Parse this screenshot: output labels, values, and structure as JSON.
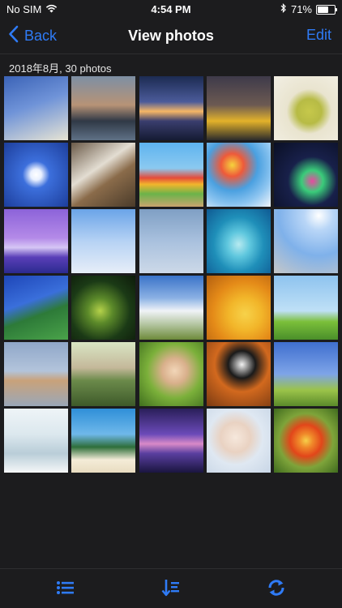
{
  "status_bar": {
    "carrier": "No SIM",
    "time": "4:54 PM",
    "battery_percent": "71%",
    "battery_level": 0.71
  },
  "nav": {
    "back_label": "Back",
    "title": "View photos",
    "edit_label": "Edit"
  },
  "section": {
    "header": "2018年8月, 30 photos"
  },
  "colors": {
    "accent": "#2f7bf6",
    "background": "#1c1c1e"
  },
  "photos": [
    {
      "subject": "child-windmill",
      "bg": "linear-gradient(160deg,#3b63b7 0%,#6f93d8 45%,#e7e4d4 100%)"
    },
    {
      "subject": "lakeside-castle",
      "bg": "linear-gradient(180deg,#7d8fa4 0%,#b79376 45%,#303946 70%,#5f7186 100%)"
    },
    {
      "subject": "sunset-horizon",
      "bg": "linear-gradient(180deg,#1c2b52 0%,#4b5b9a 40%,#f6b766 55%,#3a3e6e 70%,#151b33 100%)"
    },
    {
      "subject": "city-taxis",
      "bg": "linear-gradient(180deg,#3e3a4a 0%,#6c5a52 45%,#e3b22a 70%,#2b2b2b 100%)"
    },
    {
      "subject": "tea-cup",
      "bg": "radial-gradient(circle at 55% 55%,#c6c84b 0%,#b7bb45 25%,#e9e4cf 45%,#f2efe4 100%)"
    },
    {
      "subject": "blue-sky-cloud",
      "bg": "radial-gradient(ellipse at 50% 50%,#ffffff 0%,#e9f0ff 12%,#3c6fdc 30%,#1d3e9b 100%)"
    },
    {
      "subject": "plate-snacks",
      "bg": "linear-gradient(145deg,#6b5a48 0%,#e3ddd2 40%,#8a6b4a 60%,#4a3b2a 100%)"
    },
    {
      "subject": "beach-huts",
      "bg": "linear-gradient(180deg,#5eb4ef 0%,#8bc9f0 40%,#e44b3a 55%,#f2b52c 65%,#6bb34a 80%,#caa56e 100%)"
    },
    {
      "subject": "balloons",
      "bg": "radial-gradient(circle at 40% 35%,#f5d33c 0%,#ee5a3a 20%,#4aa0e0 45%,#8bc4f0 70%,#f2f5fa 100%)"
    },
    {
      "subject": "ferris-wheel-night",
      "bg": "radial-gradient(circle at 60% 60%,#e84aa0 0%,#3acc7a 20%,#18204a 45%,#0a0f24 100%)"
    },
    {
      "subject": "purple-trees",
      "bg": "linear-gradient(180deg,#8c63d9 0%,#b48ae8 45%,#d6c6f5 60%,#5a3fb8 75%,#2b2a8f 100%)"
    },
    {
      "subject": "ferris-wheel-day",
      "bg": "linear-gradient(180deg,#6aa4e8 0%,#b6d2f4 50%,#e7eef8 100%)"
    },
    {
      "subject": "laundry-clothesline",
      "bg": "linear-gradient(180deg,#7f9fc4 0%,#a9c1de 50%,#cdd9e8 100%)"
    },
    {
      "subject": "aerial-reef",
      "bg": "radial-gradient(ellipse at 50% 55%,#b7eaf0 0%,#5fc7de 25%,#1f8fb9 55%,#0f5a93 100%)"
    },
    {
      "subject": "man-basket",
      "bg": "radial-gradient(circle at 70% 10%,#ffffff 0%,#b9d6f7 20%,#7fb1ea 55%,#c7c7c7 100%)"
    },
    {
      "subject": "green-leaves-sky",
      "bg": "linear-gradient(160deg,#1e46b8 0%,#3a6fdb 40%,#2d7a38 60%,#4aa34a 100%)"
    },
    {
      "subject": "bubbles-bokeh",
      "bg": "radial-gradient(circle at 45% 55%,#b5d24a 0%,#5c8a2a 25%,#1b3a16 60%,#0d1a0a 100%)"
    },
    {
      "subject": "clouds-field",
      "bg": "linear-gradient(180deg,#3a73c8 0%,#8bb1e4 35%,#f0f3f7 55%,#b7c8a6 75%,#6d8a3a 100%)"
    },
    {
      "subject": "yellow-flower",
      "bg": "radial-gradient(circle at 60% 60%,#f7d24a 0%,#f2b62a 30%,#e48a18 60%,#b35f10 100%)"
    },
    {
      "subject": "bicycle-meadow",
      "bg": "linear-gradient(180deg,#8ec3ef 0%,#bfe0f6 55%,#7bbf3a 72%,#4a8f2a 100%)"
    },
    {
      "subject": "monkey-toy",
      "bg": "linear-gradient(180deg,#8fa7c9 0%,#b3c4db 45%,#c9a27a 60%,#9aa7b8 100%)"
    },
    {
      "subject": "kids-bikes",
      "bg": "linear-gradient(180deg,#d9e6c4 0%,#c4b89a 40%,#6b8a4a 60%,#3e5a2a 100%)"
    },
    {
      "subject": "girl-laughing",
      "bg": "radial-gradient(circle at 55% 45%,#f2d6b8 0%,#d9b08c 25%,#7bb03a 55%,#3f6e1e 100%)"
    },
    {
      "subject": "puppy-cushion",
      "bg": "radial-gradient(circle at 55% 35%,#f2f2f2 0%,#1a1a1a 25%,#d2691e 50%,#7a3a12 100%)"
    },
    {
      "subject": "boy-jumping",
      "bg": "linear-gradient(180deg,#3f6fcf 0%,#7ea4e8 50%,#9bc34a 75%,#5a8a2a 100%)"
    },
    {
      "subject": "white-dishes",
      "bg": "linear-gradient(180deg,#eef4f7 0%,#dce8ee 40%,#b9cdd8 70%,#f5f7f8 100%)"
    },
    {
      "subject": "palm-beach",
      "bg": "linear-gradient(180deg,#2f8fd8 0%,#6fb8ea 40%,#2e6e3a 60%,#f4ecd8 80%,#e8dcc0 100%)"
    },
    {
      "subject": "purple-dusk",
      "bg": "linear-gradient(180deg,#2a1f5a 0%,#6b4ab8 40%,#d98ac8 55%,#5a3fa0 70%,#1a1540 100%)"
    },
    {
      "subject": "baby-bubbles",
      "bg": "radial-gradient(circle at 45% 45%,#f6e8dc 0%,#e9d2c2 30%,#dfe8f2 55%,#c8d6e6 100%)"
    },
    {
      "subject": "red-gerbera",
      "bg": "radial-gradient(circle at 50% 50%,#f6d04a 0%,#f08a2a 15%,#e2461a 35%,#7ea43a 60%,#3f6a1e 100%)"
    }
  ]
}
